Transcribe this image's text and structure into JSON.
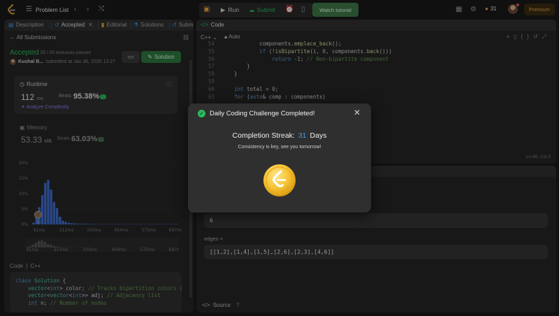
{
  "topbar": {
    "problem_list": "Problem List",
    "run": "Run",
    "submit": "Submit",
    "watch": "Watch tutorial",
    "streak": "31",
    "premium": "Premium"
  },
  "left": {
    "tabs": [
      "Description",
      "Accepted",
      "Editorial",
      "Solutions",
      "Subm"
    ],
    "all_submissions": "All Submissions",
    "status": "Accepted",
    "passed": "55 / 55 testcases passed",
    "user": "Kushal B...",
    "submitted": "submitted at Jan 30, 2025 12:27",
    "solution_btn": "Solution",
    "runtime": {
      "label": "Runtime",
      "value": "112",
      "unit": "ms",
      "beats": "Beats",
      "pct": "95.38%",
      "analyze": "Analyze Complexity"
    },
    "memory": {
      "label": "Memory",
      "value": "53.33",
      "unit": "MB",
      "beats": "Beats",
      "pct": "63.03%"
    },
    "code_label": "Code",
    "code_lang": "C++",
    "code_lines": [
      [
        "class Solution {"
      ],
      [
        "    vector<int> color; // Tracks bipartition colors (0"
      ],
      [
        "    vector<vector<int>> adj; // Adjacency list"
      ],
      [
        "    int n; // Number of nodes"
      ]
    ]
  },
  "chart_data": {
    "type": "bar",
    "ylabel": "",
    "y_ticks": [
      "20%",
      "15%",
      "10%",
      "5%",
      "0%"
    ],
    "ylim": [
      0,
      20
    ],
    "x_ticks": [
      "91ms",
      "212ms",
      "333ms",
      "454ms",
      "575ms",
      "697ms"
    ],
    "values": [
      0.6,
      2.5,
      5.6,
      9.5,
      13.5,
      14.5,
      11.3,
      7.3,
      5.3,
      2.5,
      1.2,
      0.8,
      0.5,
      0.4,
      0.3,
      0.3,
      0.2,
      0.2,
      0.2,
      0.15,
      0.15,
      0.1,
      0.1,
      0.1,
      0.1,
      0.1,
      0.1,
      0.1,
      0.1,
      0.1,
      0.1,
      0.1,
      0.1,
      0.1,
      0.1,
      0.1,
      0.1,
      0.1,
      0.1,
      0.1,
      0.1,
      0.1,
      0.1,
      0.1,
      0.1,
      0.1,
      0.1,
      0.1,
      0.1,
      0.1
    ],
    "grid": true
  },
  "code": {
    "title": "Code",
    "lang": "C++",
    "auto": "Auto",
    "line_numbers": [
      "54",
      "55",
      "56",
      "57",
      "58",
      "59",
      "60",
      "61"
    ],
    "lines": [
      "            components.emplace_back();",
      "            if (!isBipartite(i, 0, components.back()))",
      "                return -1; // Non-bipartite component",
      "        }",
      "    }",
      "",
      "    int total = 0;",
      "    for (auto& comp : components)"
    ],
    "cursor": "Ln 66, Col 3"
  },
  "testcase": {
    "n_value": "6",
    "edges_label": "edges =",
    "edges_value": "[[1,2],[1,4],[1,5],[2,6],[2,3],[4,6]]",
    "source": "Source"
  },
  "modal": {
    "title": "Daily Coding Challenge Completed!",
    "streak_label": "Completion Streak:",
    "streak_num": "31",
    "streak_unit": "Days",
    "subtitle": "Consistency is key, see you tomorrow!"
  }
}
